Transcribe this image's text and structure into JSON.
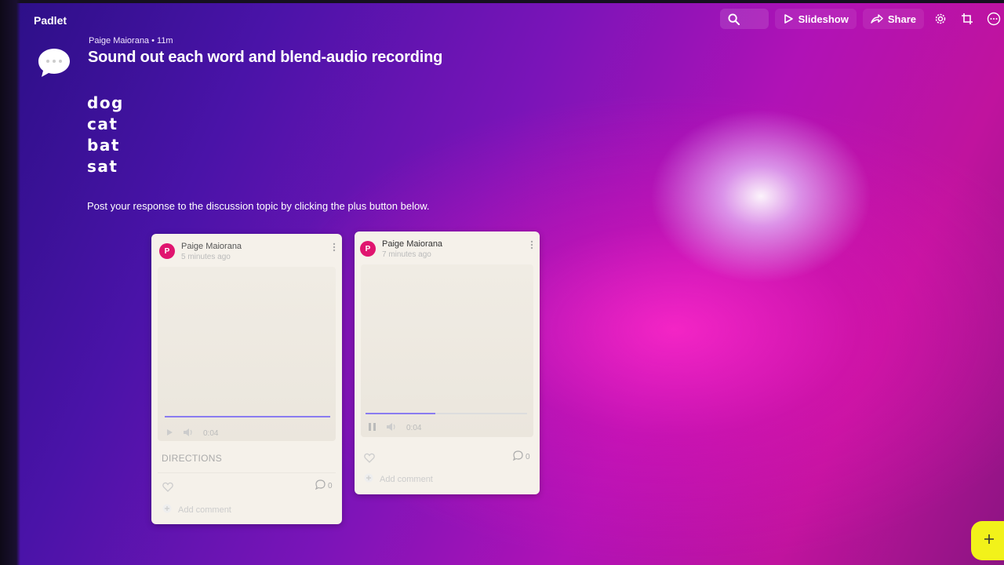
{
  "app": {
    "name": "Padlet"
  },
  "toolbar": {
    "slideshow_label": "Slideshow",
    "share_label": "Share"
  },
  "post_header": {
    "meta": "Paige Maiorana • 11m",
    "title": "Sound out each word and blend-audio recording",
    "words": [
      "dog",
      "cat",
      "bat",
      "sat"
    ],
    "instruction": "Post your response to the discussion topic by clicking the plus button below."
  },
  "cards": [
    {
      "avatar_letter": "P",
      "author": "Paige Maiorana",
      "time": "5 minutes ago",
      "audio_time": "0:04",
      "audio_progress": 1.0,
      "label": "DIRECTIONS",
      "comment_count": "0",
      "add_comment": "Add comment"
    },
    {
      "avatar_letter": "P",
      "author": "Paige Maiorana",
      "time": "7 minutes ago",
      "audio_time": "0:04",
      "audio_progress": 0.43,
      "label": "",
      "comment_count": "0",
      "add_comment": "Add comment"
    }
  ],
  "colors": {
    "accent": "#e0156f",
    "fab": "#f2f21a",
    "progress": "#8a7cf0"
  }
}
